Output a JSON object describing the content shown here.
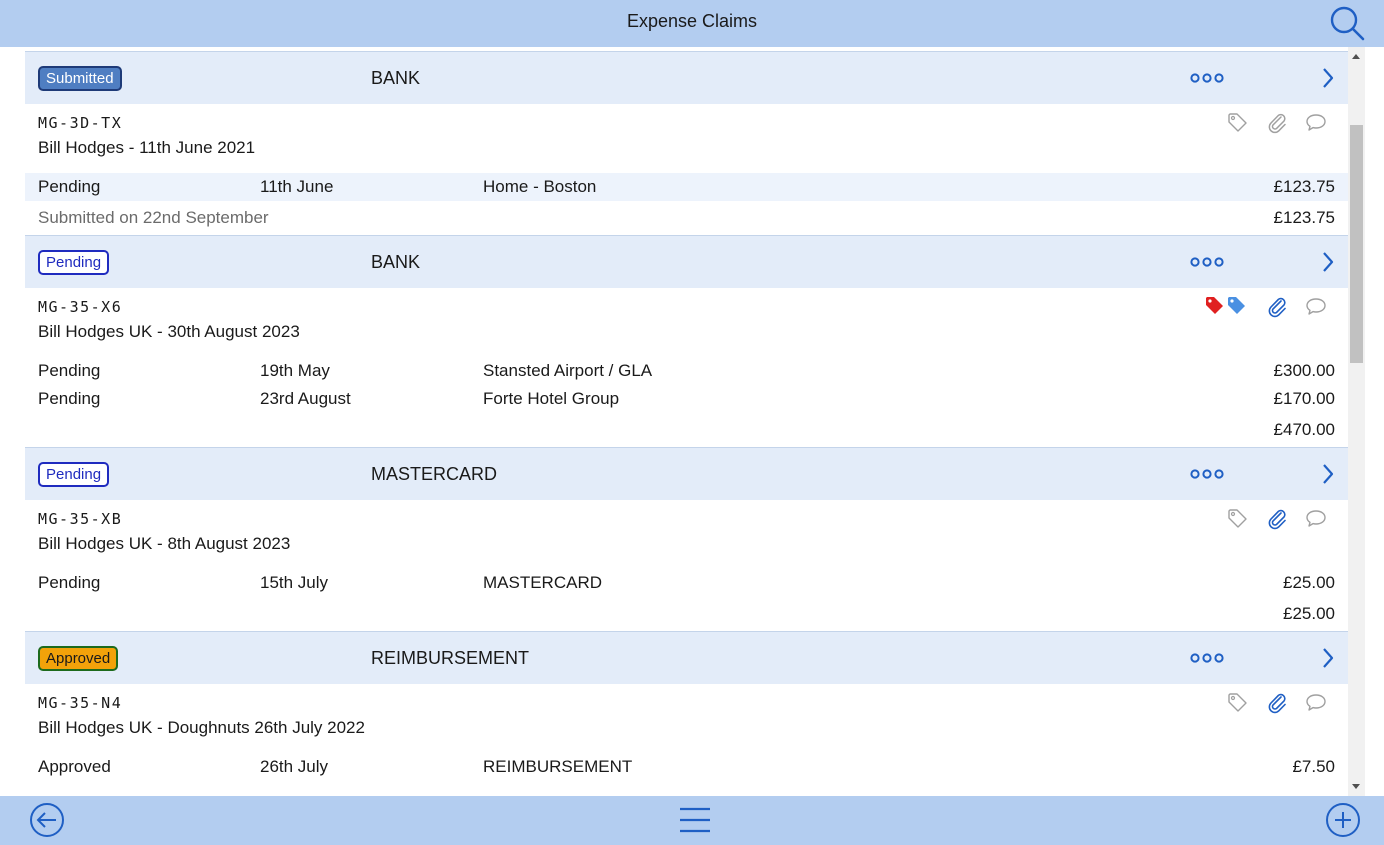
{
  "header": {
    "title": "Expense Claims",
    "search_icon": "search-icon"
  },
  "claims": [
    {
      "status": "Submitted",
      "status_kind": "submitted",
      "type": "BANK",
      "ref": "MG-3D-TX",
      "owner": "Bill Hodges",
      "sep": " - ",
      "title": "11th June 2021",
      "icons": {
        "tags": "tag-outline-icon",
        "attachment": "paperclip-grey-icon",
        "comment": "comment-icon"
      },
      "lines": [
        {
          "status": "Pending",
          "date": "11th June",
          "description": "Home - Boston",
          "amount": "£123.75"
        }
      ],
      "submitted_note": "Submitted on 22nd September",
      "total": "£123.75"
    },
    {
      "status": "Pending",
      "status_kind": "pending",
      "type": "BANK",
      "ref": "MG-35-X6",
      "owner": "Bill Hodges UK",
      "sep": " - ",
      "title": "30th August 2023",
      "icons": {
        "tags": "tag-red-blue-icon",
        "attachment": "paperclip-blue-icon",
        "comment": "comment-icon"
      },
      "lines": [
        {
          "status": "Pending",
          "date": "19th May",
          "description": "Stansted Airport / GLA",
          "amount": "£300.00"
        },
        {
          "status": "Pending",
          "date": "23rd August",
          "description": "Forte Hotel Group",
          "amount": "£170.00"
        }
      ],
      "submitted_note": "",
      "total": "£470.00"
    },
    {
      "status": "Pending",
      "status_kind": "pending",
      "type": "MASTERCARD",
      "ref": "MG-35-XB",
      "owner": "Bill Hodges UK",
      "sep": " - ",
      "title": "8th August 2023",
      "icons": {
        "tags": "tag-outline-icon",
        "attachment": "paperclip-blue-icon",
        "comment": "comment-icon"
      },
      "lines": [
        {
          "status": "Pending",
          "date": "15th July",
          "description": "MASTERCARD",
          "amount": "£25.00"
        }
      ],
      "submitted_note": "",
      "total": "£25.00"
    },
    {
      "status": "Approved",
      "status_kind": "approved",
      "type": "REIMBURSEMENT",
      "ref": "MG-35-N4",
      "owner": "Bill Hodges UK",
      "sep": " - ",
      "title": "Doughnuts 26th July 2022",
      "icons": {
        "tags": "tag-outline-icon",
        "attachment": "paperclip-blue-icon",
        "comment": "comment-icon"
      },
      "lines": [
        {
          "status": "Approved",
          "date": "26th July",
          "description": "REIMBURSEMENT",
          "amount": "£7.50"
        }
      ],
      "submitted_note": "",
      "total": ""
    }
  ],
  "footer": {
    "back_icon": "back-arrow-icon",
    "menu_icon": "hamburger-menu-icon",
    "add_icon": "add-circle-icon"
  },
  "colors": {
    "bar": "#b3cdf0",
    "claim_header": "#e3ecf9",
    "accent": "#1f5fc4",
    "tag_red": "#e02020",
    "tag_blue": "#4a90e2"
  }
}
